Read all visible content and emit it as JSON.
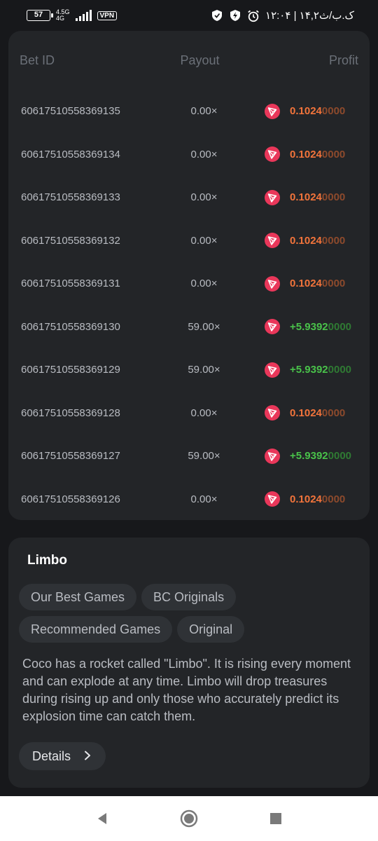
{
  "status_bar": {
    "battery": "57",
    "network": "4.5G",
    "network_sub": "4G",
    "vpn": "VPN",
    "time": "۱۲:۰۴ | ۱۴,۲ک.ب/ث"
  },
  "bets": {
    "headers": {
      "id": "Bet ID",
      "payout": "Payout",
      "profit": "Profit"
    },
    "rows": [
      {
        "id": "60617510558369135",
        "payout": "0.00×",
        "profit_bright": "0.1024",
        "profit_dim": "0000",
        "type": "loss"
      },
      {
        "id": "60617510558369134",
        "payout": "0.00×",
        "profit_bright": "0.1024",
        "profit_dim": "0000",
        "type": "loss"
      },
      {
        "id": "60617510558369133",
        "payout": "0.00×",
        "profit_bright": "0.1024",
        "profit_dim": "0000",
        "type": "loss"
      },
      {
        "id": "60617510558369132",
        "payout": "0.00×",
        "profit_bright": "0.1024",
        "profit_dim": "0000",
        "type": "loss"
      },
      {
        "id": "60617510558369131",
        "payout": "0.00×",
        "profit_bright": "0.1024",
        "profit_dim": "0000",
        "type": "loss"
      },
      {
        "id": "60617510558369130",
        "payout": "59.00×",
        "profit_bright": "+5.9392",
        "profit_dim": "0000",
        "type": "win"
      },
      {
        "id": "60617510558369129",
        "payout": "59.00×",
        "profit_bright": "+5.9392",
        "profit_dim": "0000",
        "type": "win"
      },
      {
        "id": "60617510558369128",
        "payout": "0.00×",
        "profit_bright": "0.1024",
        "profit_dim": "0000",
        "type": "loss"
      },
      {
        "id": "60617510558369127",
        "payout": "59.00×",
        "profit_bright": "+5.9392",
        "profit_dim": "0000",
        "type": "win"
      },
      {
        "id": "60617510558369126",
        "payout": "0.00×",
        "profit_bright": "0.1024",
        "profit_dim": "0000",
        "type": "loss"
      }
    ]
  },
  "game": {
    "title": "Limbo",
    "tags": [
      "Our Best Games",
      "BC Originals",
      "Recommended Games",
      "Original"
    ],
    "description": "Coco has a rocket called \"Limbo\". It is rising every moment and can explode at any time. Limbo will drop treasures during rising up and only those who accurately predict its explosion time can catch them.",
    "details_label": "Details"
  },
  "icons": {
    "coin": "tron-coin-icon",
    "details": "chevron-right-icon",
    "nav": [
      "back-icon",
      "home-icon",
      "recents-icon"
    ]
  },
  "colors": {
    "loss": "#f2743b",
    "win": "#49c24a",
    "coin": "#e9375a",
    "card": "#232528",
    "background": "#17181b"
  }
}
